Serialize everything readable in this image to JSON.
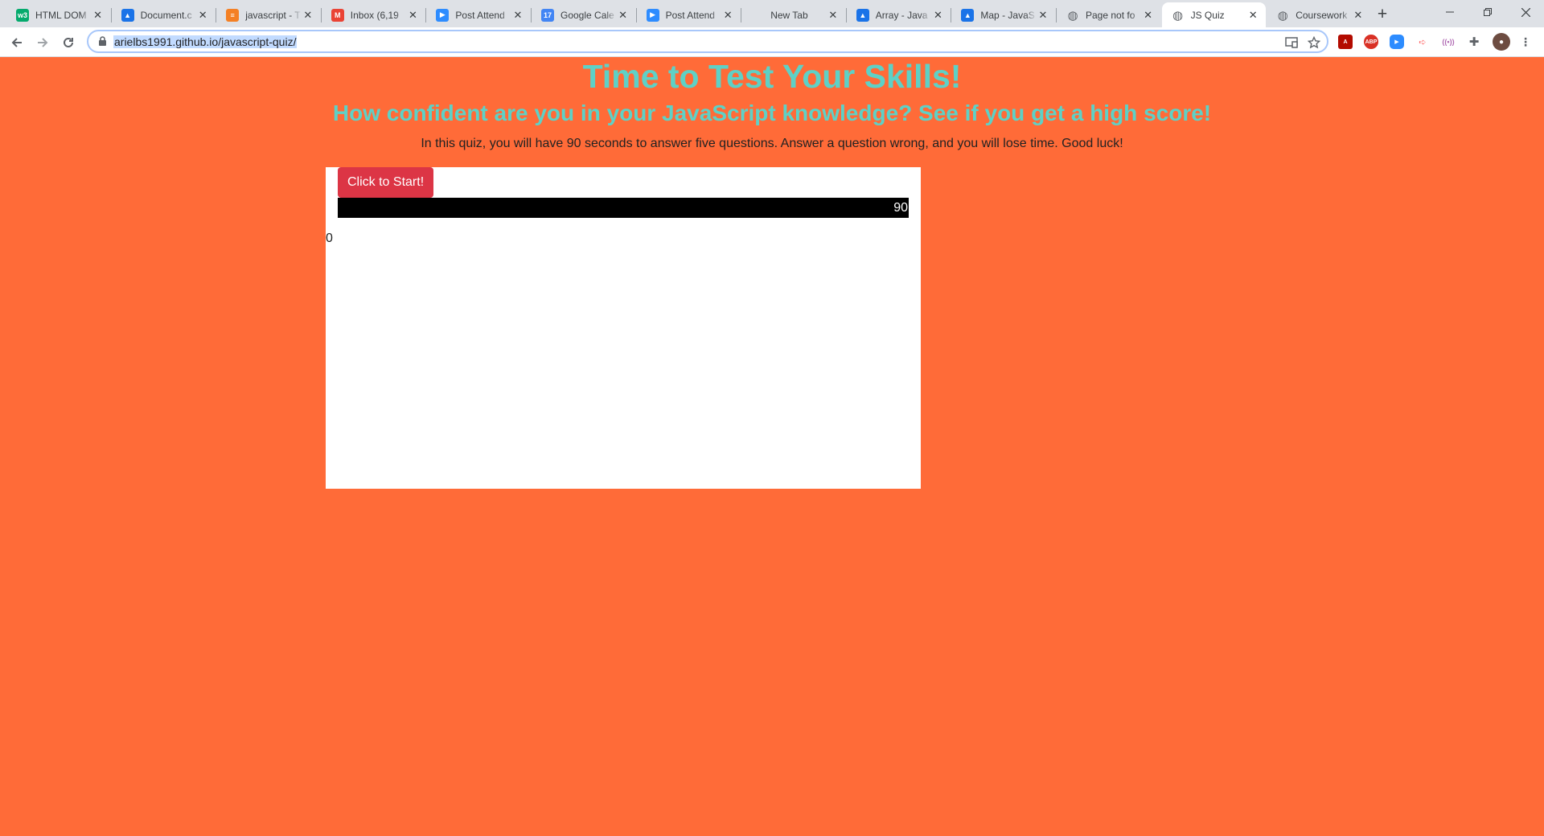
{
  "browser": {
    "tabs": [
      {
        "title": "HTML DOM",
        "icon": "w3schools-icon",
        "color": "#04aa6d",
        "glyph": "w3"
      },
      {
        "title": "Document.c",
        "icon": "mdn-icon",
        "color": "#1a73e8",
        "glyph": "▲"
      },
      {
        "title": "javascript - T",
        "icon": "stackoverflow-icon",
        "color": "#f48024",
        "glyph": "≡"
      },
      {
        "title": "Inbox (6,19",
        "icon": "gmail-icon",
        "color": "#ea4335",
        "glyph": "M"
      },
      {
        "title": "Post Attend",
        "icon": "zoom-icon",
        "color": "#2d8cff",
        "glyph": "▶"
      },
      {
        "title": "Google Cale",
        "icon": "google-calendar-icon",
        "color": "#4285f4",
        "glyph": "17"
      },
      {
        "title": "Post Attend",
        "icon": "zoom-icon",
        "color": "#2d8cff",
        "glyph": "▶"
      },
      {
        "title": "New Tab",
        "icon": "",
        "color": "",
        "glyph": ""
      },
      {
        "title": "Array - Java",
        "icon": "mdn-icon",
        "color": "#1a73e8",
        "glyph": "▲"
      },
      {
        "title": "Map - JavaS",
        "icon": "mdn-icon",
        "color": "#1a73e8",
        "glyph": "▲"
      },
      {
        "title": "Page not fo",
        "icon": "globe-icon",
        "color": "#5f6368",
        "glyph": "◍"
      },
      {
        "title": "JS Quiz",
        "icon": "globe-icon",
        "color": "#5f6368",
        "glyph": "◍"
      },
      {
        "title": "Coursework",
        "icon": "globe-icon",
        "color": "#5f6368",
        "glyph": "◍"
      }
    ],
    "active_tab": 11,
    "url": "arielbs1991.github.io/javascript-quiz/"
  },
  "page": {
    "title": "Time to Test Your Skills!",
    "subtitle": "How confident are you in your JavaScript knowledge? See if you get a high score!",
    "intro": "In this quiz, you will have 90 seconds to answer five questions. Answer a question wrong, and you will lose time. Good luck!",
    "start_button": "Click to Start!",
    "timer": "90",
    "score": "0"
  },
  "colors": {
    "background": "#ff6b38",
    "heading": "#5ed1c6",
    "start_button": "#dc3545",
    "timer_bar": "#000000"
  }
}
